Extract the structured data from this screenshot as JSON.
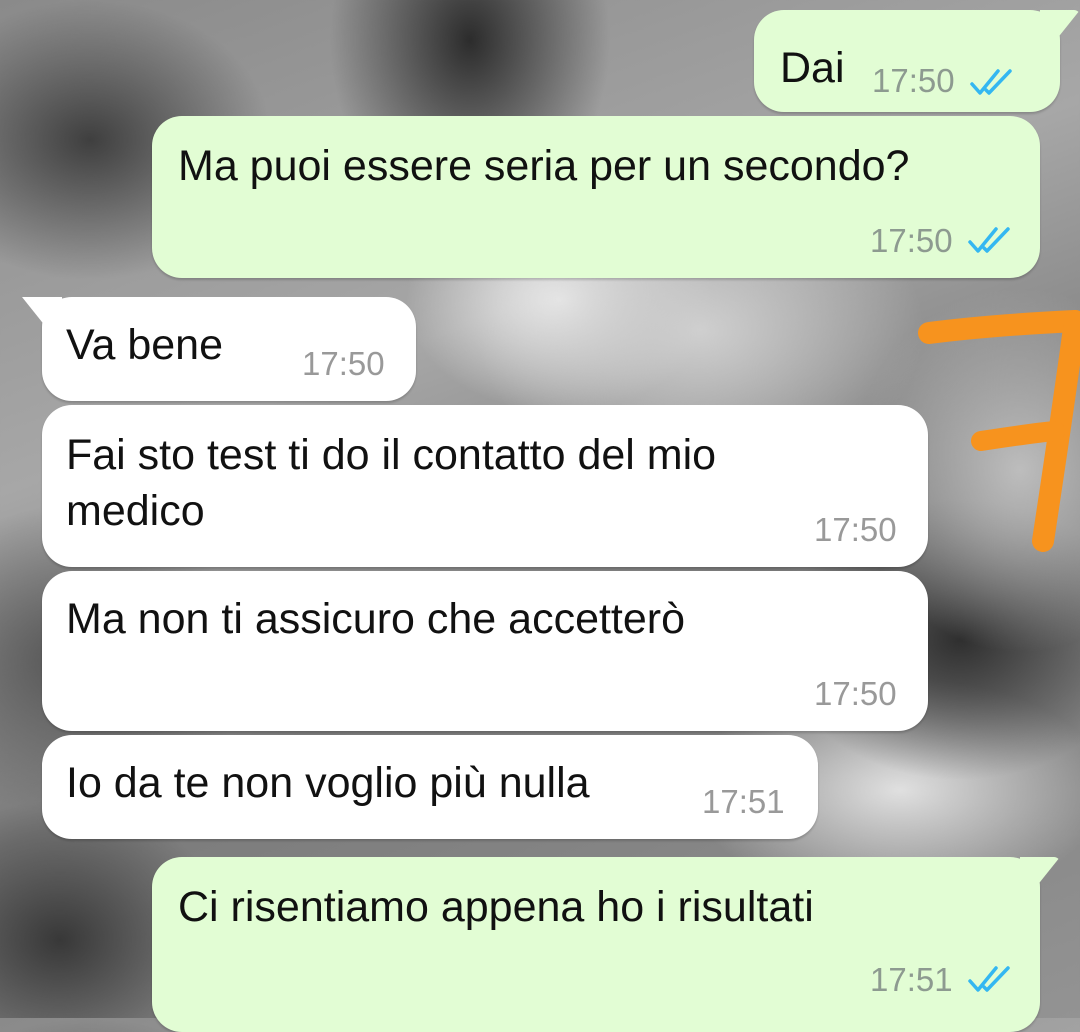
{
  "messages": [
    {
      "direction": "out",
      "text": "Dai",
      "time": "17:50",
      "status": "read"
    },
    {
      "direction": "out",
      "text": "Ma puoi essere seria per un secondo?",
      "time": "17:50",
      "status": "read"
    },
    {
      "direction": "in",
      "text": "Va bene",
      "time": "17:50"
    },
    {
      "direction": "in",
      "text_line1": "Fai sto test ti do il contatto del mio",
      "text_line2": "medico",
      "time": "17:50"
    },
    {
      "direction": "in",
      "text": "Ma non ti assicuro che accetterò",
      "time": "17:50"
    },
    {
      "direction": "in",
      "text": "Io da te non voglio più nulla",
      "time": "17:51"
    },
    {
      "direction": "out",
      "text": "Ci risentiamo appena ho i risultati",
      "time": "17:51",
      "status": "read"
    }
  ],
  "colors": {
    "outgoing_bubble": "#e2fdd4",
    "incoming_bubble": "#ffffff",
    "read_ticks": "#34b7f1",
    "annotation": "#f7931e"
  },
  "icons": {
    "read_receipt": "double-check-icon",
    "annotation": "orange-scribble"
  }
}
